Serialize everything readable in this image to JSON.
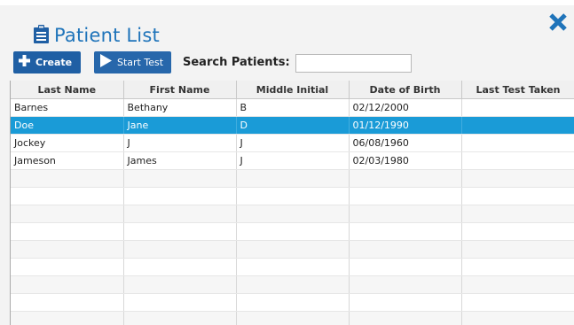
{
  "dialog": {
    "title": "Patient List",
    "close_icon": "close-x-icon",
    "accent_color": "#1f74ba"
  },
  "toolbar": {
    "create_label": "Create",
    "start_test_label": "Start Test",
    "search_label": "Search Patients:",
    "search_value": ""
  },
  "table": {
    "columns": [
      "Last Name",
      "First Name",
      "Middle Initial",
      "Date of Birth",
      "Last Test Taken"
    ],
    "rows": [
      {
        "last": "Barnes",
        "first": "Bethany",
        "middle": "B",
        "dob": "02/12/2000",
        "last_test": ""
      },
      {
        "last": "Doe",
        "first": "Jane",
        "middle": "D",
        "dob": "01/12/1990",
        "last_test": ""
      },
      {
        "last": "Jockey",
        "first": "J",
        "middle": "J",
        "dob": "06/08/1960",
        "last_test": ""
      },
      {
        "last": "Jameson",
        "first": "James",
        "middle": "J",
        "dob": "02/03/1980",
        "last_test": ""
      }
    ],
    "selected_row": 1,
    "selection_color": "#1a9bd7"
  }
}
